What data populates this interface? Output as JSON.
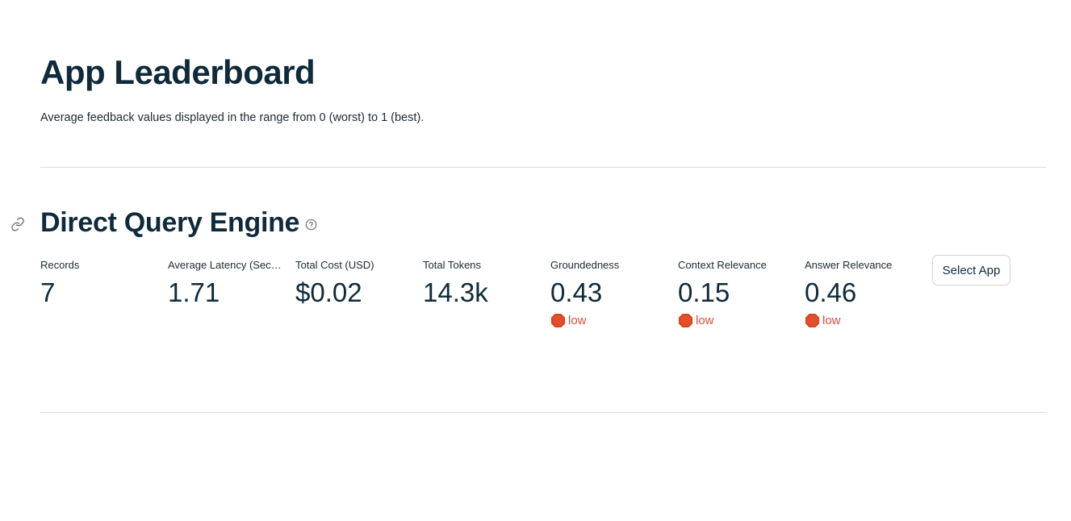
{
  "header": {
    "title": "App Leaderboard",
    "subtitle": "Average feedback values displayed in the range from 0 (worst) to 1 (best)."
  },
  "app": {
    "name": "Direct Query Engine",
    "anchor_icon": "link-icon",
    "help_icon": "question-circle-icon",
    "metrics": [
      {
        "label": "Records",
        "value": "7"
      },
      {
        "label": "Average Latency (Seconds)",
        "value": "1.71"
      },
      {
        "label": "Total Cost (USD)",
        "value": "$0.02"
      },
      {
        "label": "Total Tokens",
        "value": "14.3k"
      },
      {
        "label": "Groundedness",
        "value": "0.43",
        "delta": "low",
        "delta_icon": "stop-sign-icon"
      },
      {
        "label": "Context Relevance",
        "value": "0.15",
        "delta": "low",
        "delta_icon": "stop-sign-icon"
      },
      {
        "label": "Answer Relevance",
        "value": "0.46",
        "delta": "low",
        "delta_icon": "stop-sign-icon"
      }
    ],
    "select_button_label": "Select App"
  },
  "colors": {
    "text": "#0f2a3a",
    "delta_bad": "#e34b3c",
    "divider": "#d9dcdf"
  }
}
